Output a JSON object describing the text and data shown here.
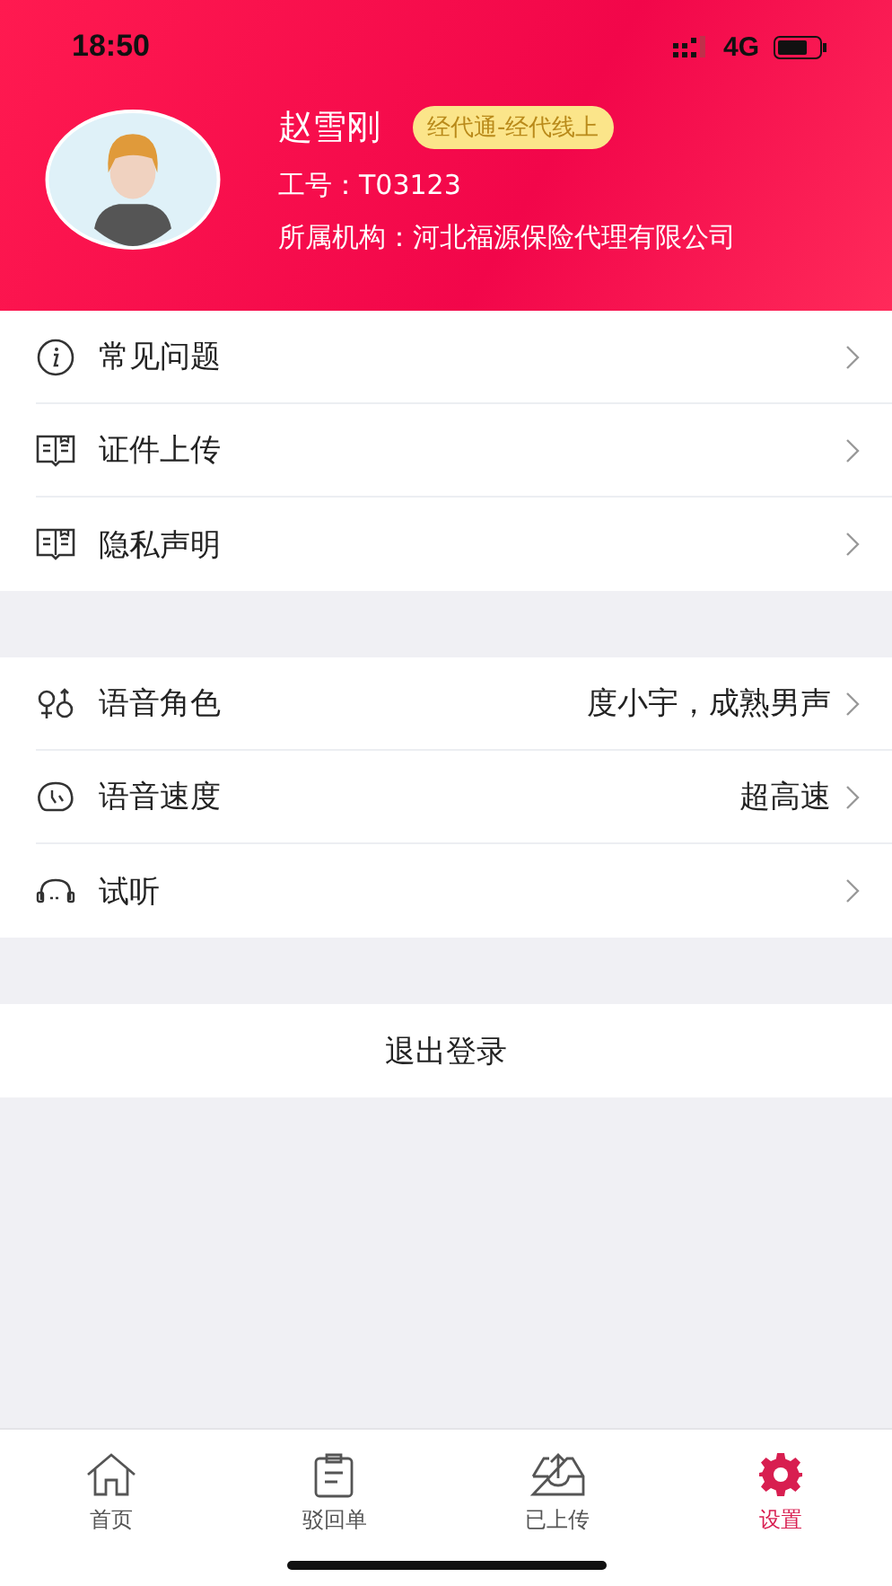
{
  "status_bar": {
    "time": "18:50",
    "network": "4G"
  },
  "profile": {
    "name": "赵雪刚",
    "badge": "经代通-经代线上",
    "employee_id": "工号：T03123",
    "organization": "所属机构：河北福源保险代理有限公司"
  },
  "sections": [
    {
      "items": [
        {
          "kind": "info",
          "label": "常见问题"
        },
        {
          "kind": "document",
          "label": "证件上传"
        },
        {
          "kind": "document",
          "label": "隐私声明"
        }
      ]
    },
    {
      "items": [
        {
          "kind": "voice",
          "label": "语音角色",
          "value": "度小宇，成熟男声"
        },
        {
          "kind": "speed",
          "label": "语音速度",
          "value": "超高速"
        },
        {
          "kind": "listen",
          "label": "试听"
        }
      ]
    }
  ],
  "logout": "退出登录",
  "tabs": [
    {
      "kind": "home",
      "label": "首页",
      "selected": false
    },
    {
      "kind": "form",
      "label": "驳回单",
      "selected": false
    },
    {
      "kind": "upload",
      "label": "已上传",
      "selected": false
    },
    {
      "kind": "settings",
      "label": "设置",
      "selected": true
    }
  ]
}
